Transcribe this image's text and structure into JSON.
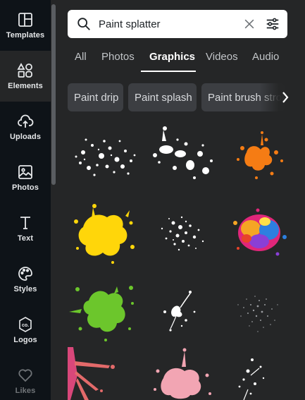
{
  "sidebar": {
    "items": [
      {
        "label": "Templates",
        "icon": "templates-icon"
      },
      {
        "label": "Elements",
        "icon": "elements-icon"
      },
      {
        "label": "Uploads",
        "icon": "upload-cloud-icon"
      },
      {
        "label": "Photos",
        "icon": "photo-icon"
      },
      {
        "label": "Text",
        "icon": "text-icon"
      },
      {
        "label": "Styles",
        "icon": "palette-icon"
      },
      {
        "label": "Logos",
        "icon": "logo-icon"
      },
      {
        "label": "Likes",
        "icon": "heart-icon"
      }
    ],
    "active": "Elements"
  },
  "search": {
    "value": "Paint splatter"
  },
  "tabs": {
    "items": [
      "All",
      "Photos",
      "Graphics",
      "Videos",
      "Audio"
    ],
    "active": "Graphics"
  },
  "chips": [
    "Paint drip",
    "Paint splash",
    "Paint brush stroke"
  ],
  "results": [
    {
      "name": "white-splatter",
      "color": "#ffffff"
    },
    {
      "name": "white-splash",
      "color": "#ffffff"
    },
    {
      "name": "orange-splash",
      "color": "#f57c14"
    },
    {
      "name": "yellow-splash",
      "color": "#ffd60a"
    },
    {
      "name": "white-dots-splatter",
      "color": "#ffffff"
    },
    {
      "name": "rainbow-splash",
      "color": "#e0267a"
    },
    {
      "name": "green-splash",
      "color": "#6cc62c"
    },
    {
      "name": "white-drips",
      "color": "#ffffff"
    },
    {
      "name": "grey-spray",
      "color": "#9a9ca0"
    },
    {
      "name": "pink-streaks",
      "color": "#e95a70"
    },
    {
      "name": "pink-splash",
      "color": "#f2a5b3"
    },
    {
      "name": "white-specks",
      "color": "#ffffff"
    }
  ],
  "theme": {
    "sidebar_bg": "#0e1318",
    "panel_bg": "#252627",
    "chip_bg": "#3c3e42"
  }
}
